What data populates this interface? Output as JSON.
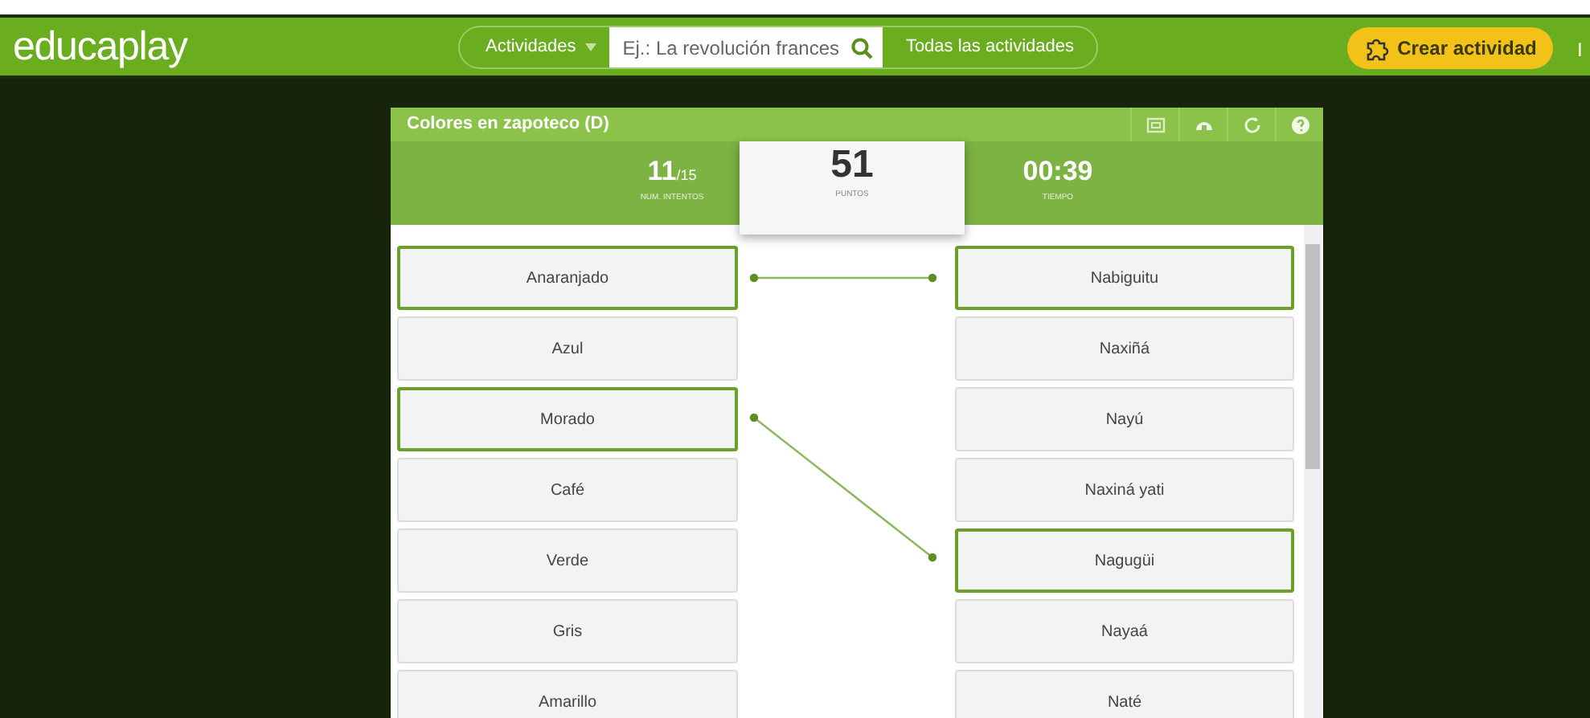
{
  "header": {
    "logo": "educaplay",
    "category_button": "Actividades",
    "search": {
      "placeholder": "Ej.: La revolución frances"
    },
    "all_activities": "Todas las actividades",
    "create_button": "Crear actividad",
    "cut_link": "I"
  },
  "activity": {
    "title": "Colores en zapoteco (D)",
    "attempts": {
      "value": "11",
      "total": "/15",
      "label": "NUM. INTENTOS"
    },
    "score": {
      "value": "51",
      "label": "PUNTOS"
    },
    "time": {
      "value": "00:39",
      "label": "TIEMPO"
    },
    "left_items": [
      {
        "label": "Anaranjado",
        "selected": true
      },
      {
        "label": "Azul",
        "selected": false
      },
      {
        "label": "Morado",
        "selected": true
      },
      {
        "label": "Café",
        "selected": false
      },
      {
        "label": "Verde",
        "selected": false
      },
      {
        "label": "Gris",
        "selected": false
      },
      {
        "label": "Amarillo",
        "selected": false
      }
    ],
    "right_items": [
      {
        "label": "Nabiguitu",
        "selected": true
      },
      {
        "label": "Naxiñá",
        "selected": false
      },
      {
        "label": "Nayú",
        "selected": false
      },
      {
        "label": "Naxiná yati",
        "selected": false
      },
      {
        "label": "Nagugüi",
        "selected": true
      },
      {
        "label": "Nayaá",
        "selected": false
      },
      {
        "label": "Naté",
        "selected": false
      }
    ]
  }
}
